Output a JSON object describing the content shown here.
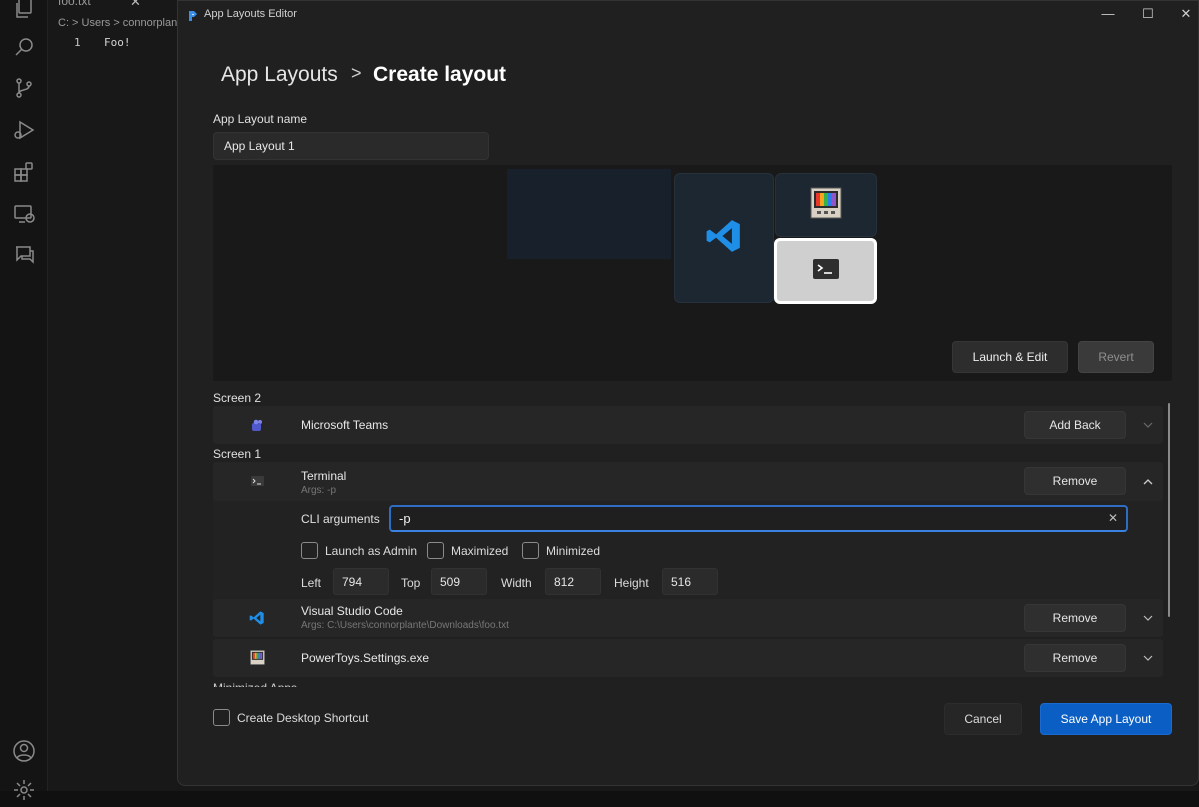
{
  "background_editor": {
    "tab_title": "foo.txt",
    "breadcrumb": "C: > Users > connorplan",
    "line_number": "1",
    "line_text": "Foo!",
    "activity_icons": [
      "explorer-icon",
      "search-icon",
      "source-control-icon",
      "run-debug-icon",
      "extensions-icon",
      "remote-explorer-icon",
      "chat-icon"
    ],
    "bottom_icons": [
      "account-icon",
      "settings-gear-icon"
    ]
  },
  "window": {
    "title": "App Layouts Editor",
    "controls": {
      "minimize": "—",
      "maximize": "☐",
      "close": "✕"
    }
  },
  "breadcrumb": {
    "root": "App Layouts",
    "separator": ">",
    "current": "Create layout"
  },
  "layout_name": {
    "label": "App Layout name",
    "value": "App Layout 1"
  },
  "preview": {
    "tiles": [
      "Visual Studio Code",
      "PowerToys.Settings.exe",
      "Terminal"
    ],
    "selected_tile": "Terminal",
    "launch_edit_label": "Launch & Edit",
    "revert_label": "Revert"
  },
  "groups": [
    {
      "label": "Screen 2",
      "apps": [
        {
          "name": "Microsoft Teams",
          "args": "",
          "action": "Add Back",
          "expanded": false,
          "icon": "teams-icon"
        }
      ]
    },
    {
      "label": "Screen 1",
      "apps": [
        {
          "name": "Terminal",
          "args": "Args: -p",
          "action": "Remove",
          "expanded": true,
          "icon": "terminal-icon"
        },
        {
          "name": "Visual Studio Code",
          "args": "Args: C:\\Users\\connorplante\\Downloads\\foo.txt",
          "action": "Remove",
          "expanded": false,
          "icon": "vscode-icon"
        },
        {
          "name": "PowerToys.Settings.exe",
          "args": "",
          "action": "Remove",
          "expanded": false,
          "icon": "powertoys-icon"
        }
      ]
    }
  ],
  "terminal_details": {
    "cli_label": "CLI arguments",
    "cli_value": "-p",
    "checkboxes": [
      {
        "label": "Launch as Admin",
        "checked": false
      },
      {
        "label": "Maximized",
        "checked": false
      },
      {
        "label": "Minimized",
        "checked": false
      }
    ],
    "position": {
      "left_label": "Left",
      "left": "794",
      "top_label": "Top",
      "top": "509",
      "width_label": "Width",
      "width": "812",
      "height_label": "Height",
      "height": "516"
    }
  },
  "minimized_apps_label": "Minimized Apps",
  "footer": {
    "shortcut_label": "Create Desktop Shortcut",
    "shortcut_checked": false,
    "cancel_label": "Cancel",
    "save_label": "Save App Layout"
  },
  "colors": {
    "accent": "#0b5fc4",
    "focus_border": "#2f6dc4",
    "window_bg": "#202020",
    "row_bg": "#262626"
  }
}
